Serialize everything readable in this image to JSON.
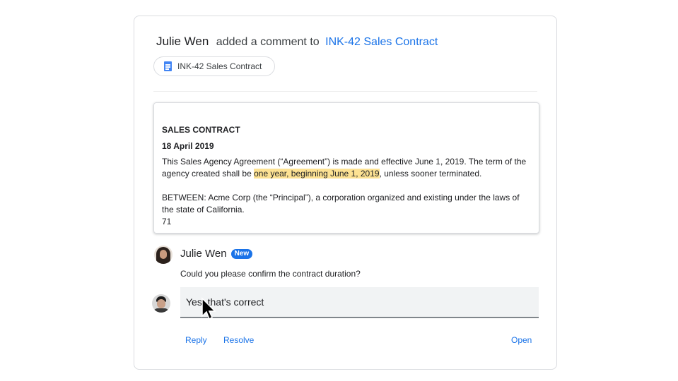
{
  "header": {
    "author": "Julie Wen",
    "action": "added a comment to",
    "doc_link": "INK-42 Sales Contract"
  },
  "chip": {
    "label": "INK-42 Sales Contract",
    "icon": "google-doc-icon"
  },
  "preview": {
    "title": "SALES CONTRACT",
    "date": "18 April 2019",
    "para1_before": "This Sales Agency Agreement (“Agreement”) is made and effective June 1, 2019. The term of the agency created shall be ",
    "para1_highlight": "one year, beginning June 1, 2019",
    "para1_after": ", unless sooner terminated.",
    "para2": "BETWEEN: Acme Corp (the “Principal”), a corporation organized and existing under the laws of the state of California.",
    "page_number": "71"
  },
  "comment": {
    "author": "Julie Wen",
    "badge": "New",
    "text": "Could you please confirm the contract duration?"
  },
  "reply": {
    "value": "Yes, that's correct"
  },
  "actions": {
    "reply": "Reply",
    "resolve": "Resolve",
    "open": "Open"
  },
  "colors": {
    "link": "#1a73e8",
    "highlight": "#fde293",
    "badge": "#1a73e8"
  }
}
